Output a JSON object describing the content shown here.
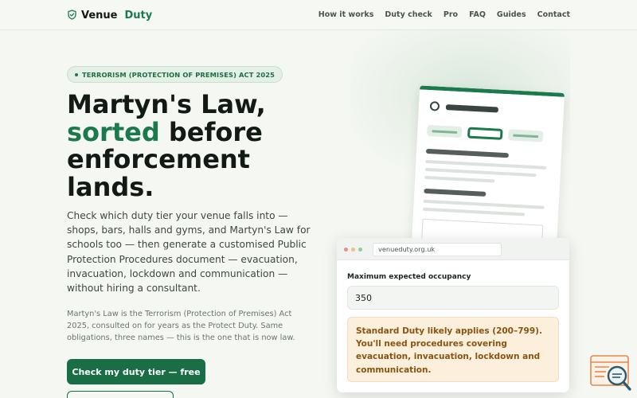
{
  "brand": {
    "name_part1": "Venue",
    "name_part2": "Duty"
  },
  "nav": {
    "links": [
      "How it works",
      "Duty check",
      "Pro",
      "FAQ",
      "Guides",
      "Contact"
    ]
  },
  "hero": {
    "badge": "TERRORISM (PROTECTION OF PREMISES) ACT 2025",
    "headline_part1": "Martyn's Law,",
    "headline_highlight": "sorted",
    "headline_part2": " before enforcement lands.",
    "lede": "Check which duty tier your venue falls into — shops, bars, halls and gyms, and Martyn's Law for schools too — then generate a customised Public Protection Procedures document — evacuation, invacuation, lockdown and communication — without hiring a consultant.",
    "small_print": "Martyn's Law is the Terrorism (Protection of Premises) Act 2025, consulted on for years as the Protect Duty. Same obligations, three names — this is the one that is now law.",
    "cta_primary": "Check my duty tier — free"
  },
  "browser_mock": {
    "url": "venueduty.org.uk",
    "field_label": "Maximum expected occupancy",
    "field_value": "350",
    "result_text": "Standard Duty likely applies (200–799). You'll need procedures covering evacuation, invacuation, lockdown and communication."
  },
  "colors": {
    "accent": "#1a7a4c",
    "accent_dark": "#1a6e45",
    "warning_bg": "#fcefdc",
    "warning_text": "#8a5410",
    "background": "#f4f7f2"
  },
  "icons": {
    "brand": "shield-check-icon",
    "corner": "document-search-icon"
  }
}
